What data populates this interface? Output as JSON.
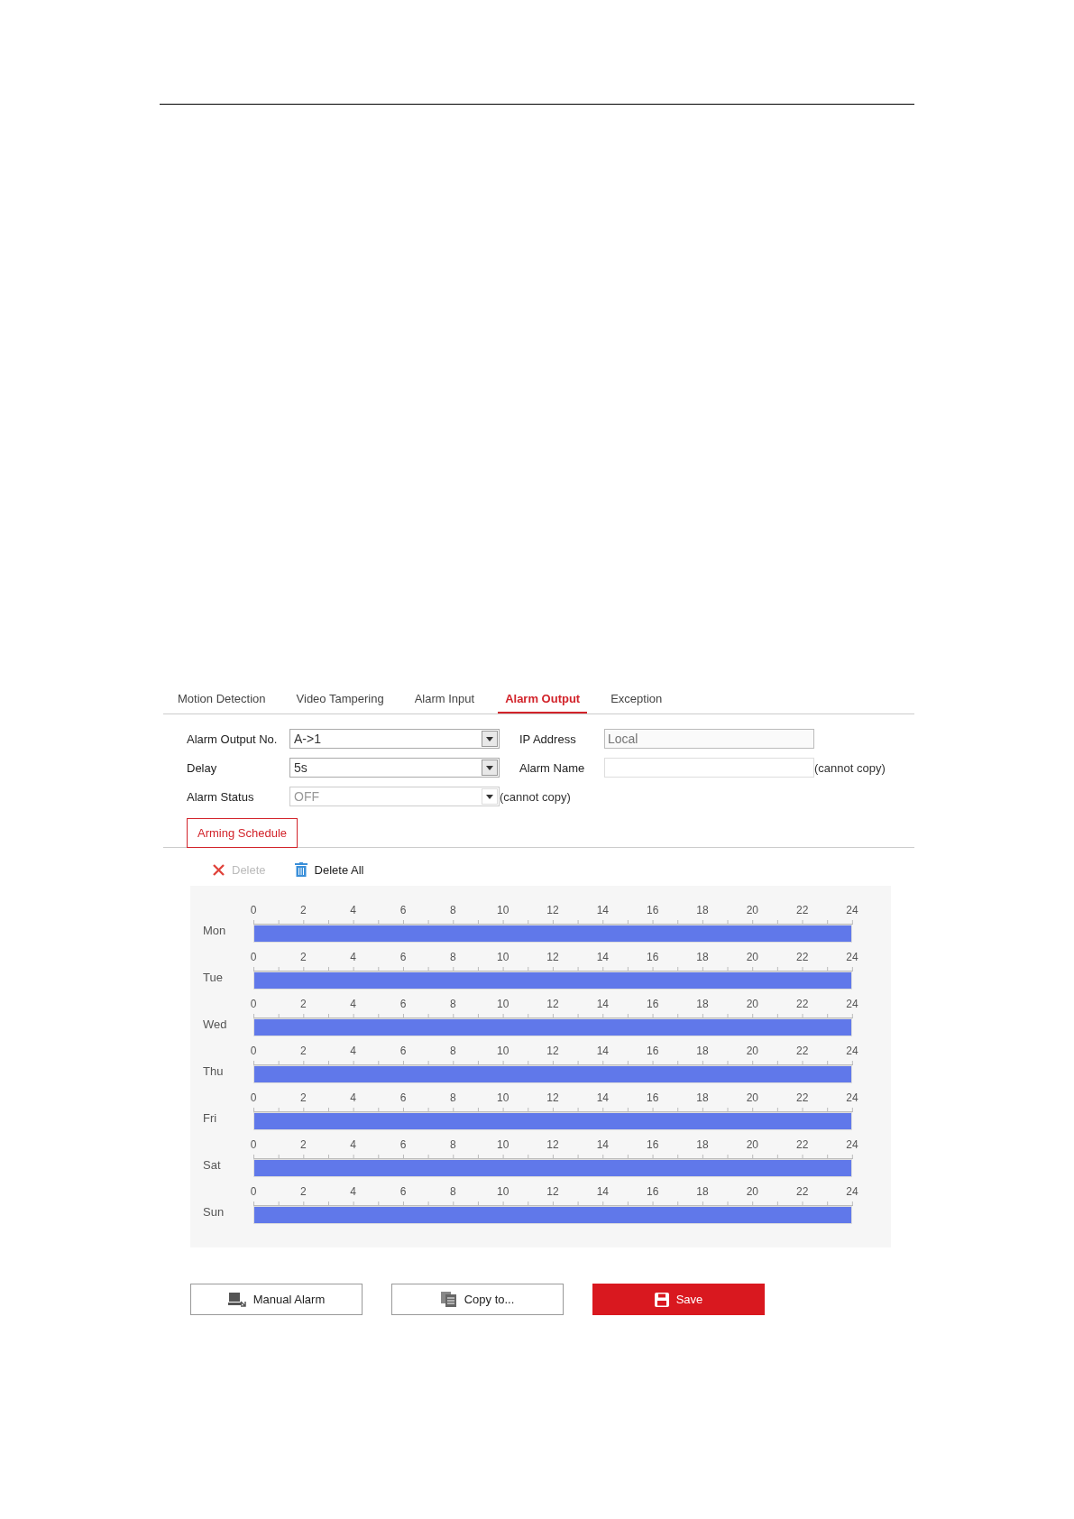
{
  "tabs": [
    {
      "label": "Motion Detection",
      "selected": false
    },
    {
      "label": "Video Tampering",
      "selected": false
    },
    {
      "label": "Alarm Input",
      "selected": false
    },
    {
      "label": "Alarm Output",
      "selected": true
    },
    {
      "label": "Exception",
      "selected": false
    }
  ],
  "form": {
    "alarm_output_no": {
      "label": "Alarm Output No.",
      "value": "A->1"
    },
    "delay": {
      "label": "Delay",
      "value": "5s"
    },
    "alarm_status": {
      "label": "Alarm Status",
      "value": "OFF",
      "disabled": true,
      "note": "(cannot copy)"
    },
    "ip_address": {
      "label": "IP Address",
      "placeholder": "Local"
    },
    "alarm_name": {
      "label": "Alarm Name",
      "note": "(cannot copy)"
    }
  },
  "schedule_tab": {
    "label": "Arming Schedule"
  },
  "toolbar": [
    {
      "kind": "delete",
      "label": "Delete",
      "disabled": true
    },
    {
      "kind": "trash",
      "label": "Delete All",
      "disabled": false
    }
  ],
  "schedule": [
    {
      "day": "Mon",
      "level": 1,
      "ticks": [
        "0",
        "2",
        "4",
        "6",
        "8",
        "10",
        "12",
        "14",
        "16",
        "18",
        "20",
        "22",
        "24"
      ]
    },
    {
      "day": "Tue",
      "level": 1,
      "ticks": [
        "0",
        "2",
        "4",
        "6",
        "8",
        "10",
        "12",
        "14",
        "16",
        "18",
        "20",
        "22",
        "24"
      ]
    },
    {
      "day": "Wed",
      "level": 1,
      "ticks": [
        "0",
        "2",
        "4",
        "6",
        "8",
        "10",
        "12",
        "14",
        "16",
        "18",
        "20",
        "22",
        "24"
      ]
    },
    {
      "day": "Thu",
      "level": 1,
      "ticks": [
        "0",
        "2",
        "4",
        "6",
        "8",
        "10",
        "12",
        "14",
        "16",
        "18",
        "20",
        "22",
        "24"
      ]
    },
    {
      "day": "Fri",
      "level": 1,
      "ticks": [
        "0",
        "2",
        "4",
        "6",
        "8",
        "10",
        "12",
        "14",
        "16",
        "18",
        "20",
        "22",
        "24"
      ]
    },
    {
      "day": "Sat",
      "level": 1,
      "ticks": [
        "0",
        "2",
        "4",
        "6",
        "8",
        "10",
        "12",
        "14",
        "16",
        "18",
        "20",
        "22",
        "24"
      ]
    },
    {
      "day": "Sun",
      "level": 1,
      "ticks": [
        "0",
        "2",
        "4",
        "6",
        "8",
        "10",
        "12",
        "14",
        "16",
        "18",
        "20",
        "22",
        "24"
      ]
    }
  ],
  "buttons": [
    {
      "kind": "manual",
      "label": "Manual Alarm"
    },
    {
      "kind": "copy",
      "label": "Copy to..."
    },
    {
      "kind": "save",
      "label": "Save"
    }
  ]
}
